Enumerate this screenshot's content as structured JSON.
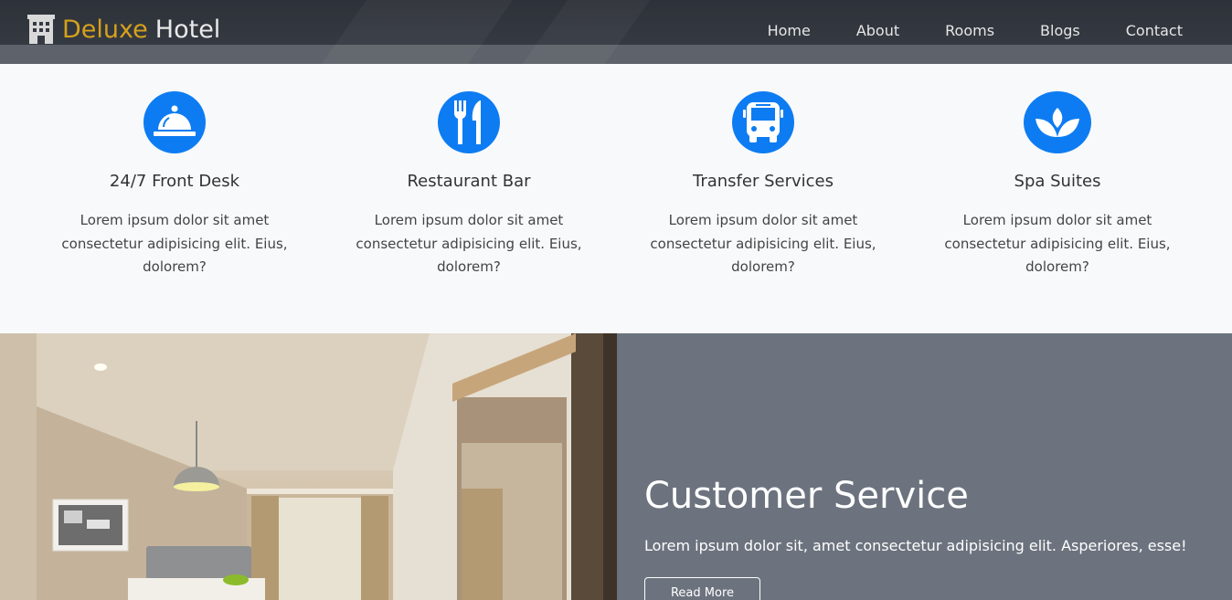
{
  "brand": {
    "word1": "Deluxe",
    "word2": "Hotel",
    "icon": "hotel-icon"
  },
  "nav": {
    "items": [
      "Home",
      "About",
      "Rooms",
      "Blogs",
      "Contact"
    ]
  },
  "features": [
    {
      "icon": "bell-icon",
      "title": "24/7 Front Desk",
      "text": "Lorem ipsum dolor sit amet consectetur adipisicing elit. Eius, dolorem?"
    },
    {
      "icon": "utensils-icon",
      "title": "Restaurant Bar",
      "text": "Lorem ipsum dolor sit amet consectetur adipisicing elit. Eius, dolorem?"
    },
    {
      "icon": "bus-icon",
      "title": "Transfer Services",
      "text": "Lorem ipsum dolor sit amet consectetur adipisicing elit. Eius, dolorem?"
    },
    {
      "icon": "spa-icon",
      "title": "Spa Suites",
      "text": "Lorem ipsum dolor sit amet consectetur adipisicing elit. Eius, dolorem?"
    }
  ],
  "service": {
    "title": "Customer Service",
    "text": "Lorem ipsum dolor sit, amet consectetur adipisicing elit. Asperiores, esse!",
    "button": "Read More"
  },
  "colors": {
    "accent": "#0d7cf2",
    "brand_gold": "#d6a11b",
    "panel_gray": "#6c737e",
    "navbar_dark": "#2d3138"
  }
}
